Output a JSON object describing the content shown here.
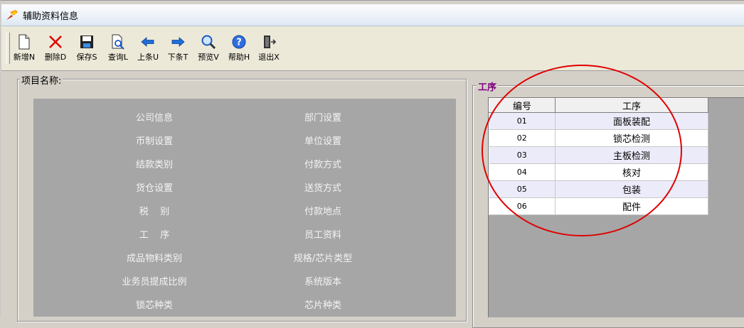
{
  "window": {
    "title": "辅助资料信息"
  },
  "toolbar": {
    "buttons": [
      {
        "key": "new",
        "label": "新增N"
      },
      {
        "key": "delete",
        "label": "删除D"
      },
      {
        "key": "save",
        "label": "保存S"
      },
      {
        "key": "query",
        "label": "查询L"
      },
      {
        "key": "prev",
        "label": "上条U"
      },
      {
        "key": "next",
        "label": "下条T"
      },
      {
        "key": "preview",
        "label": "预览V"
      },
      {
        "key": "help",
        "label": "帮助H"
      },
      {
        "key": "exit",
        "label": "退出X"
      }
    ]
  },
  "items_group": {
    "legend": "项目名称:",
    "left": [
      "公司信息",
      "币制设置",
      "结款类别",
      "货仓设置",
      "税    别",
      "工    序",
      "成品物料类别",
      "业务员提成比例",
      "锁芯种类"
    ],
    "right": [
      "部门设置",
      "单位设置",
      "付款方式",
      "送货方式",
      "付款地点",
      "员工资料",
      "规格/芯片类型",
      "系统版本",
      "芯片种类"
    ]
  },
  "process_group": {
    "legend": "工序",
    "columns": [
      "编号",
      "工序"
    ],
    "rows": [
      {
        "code": "01",
        "name": "面板装配"
      },
      {
        "code": "02",
        "name": "锁芯检测"
      },
      {
        "code": "03",
        "name": "主板检测"
      },
      {
        "code": "04",
        "name": "核对"
      },
      {
        "code": "05",
        "name": "包装"
      },
      {
        "code": "06",
        "name": "配件"
      }
    ]
  },
  "colors": {
    "legend_accent": "#800080",
    "annotation": "#e00000"
  }
}
